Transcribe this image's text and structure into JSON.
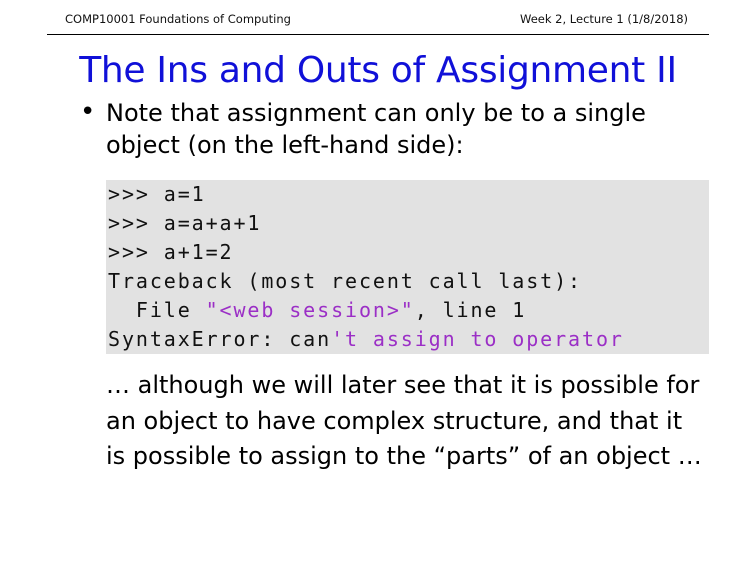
{
  "header": {
    "course": "COMP10001 Foundations of Computing",
    "lecture": "Week 2, Lecture 1 (1/8/2018)"
  },
  "slide": {
    "title": "The Ins and Outs of Assignment II",
    "bullet": {
      "marker": "•",
      "line1": "Note that assignment can only be to a single",
      "line2": "object (on the left-hand side):"
    },
    "code": {
      "line1": ">>> a=1",
      "line2": ">>> a=a+a+1",
      "line3": ">>> a+1=2",
      "line4": "Traceback (most recent call last):",
      "line5_prefix": "  File ",
      "line5_string": "\"<web session>\"",
      "line5_suffix": ", line 1",
      "line6_prefix": "SyntaxError: can",
      "line6_string": "'t assign to operator"
    },
    "followup": {
      "line1": "… although we will later see that it is possible for",
      "line2": "an object to have complex structure, and that it",
      "line3": "is possible to assign to the “parts” of an object …"
    }
  }
}
